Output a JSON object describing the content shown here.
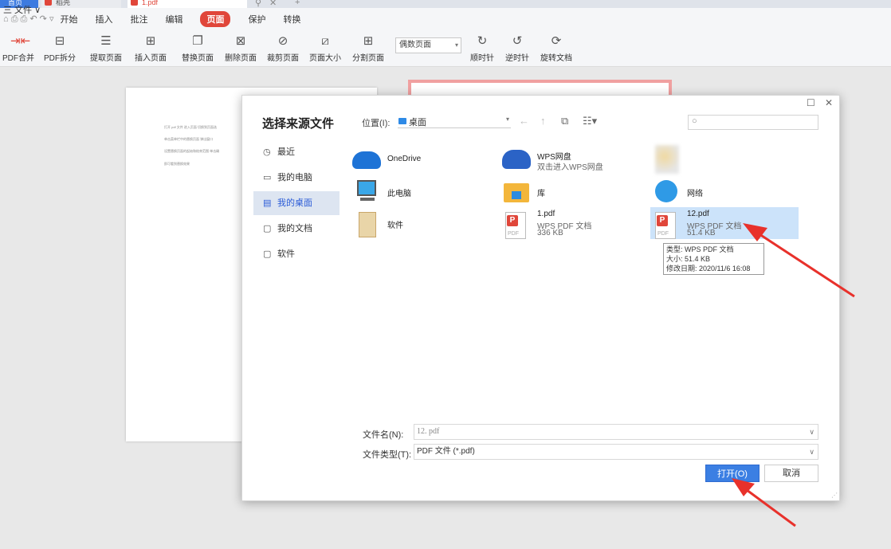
{
  "tabs": {
    "home": "首页",
    "doc1": "稻壳",
    "doc2": "1.pdf"
  },
  "menu": {
    "file": "三 文件 ∨",
    "quick_access": "⌂ ⎙ ⎙ ↶ ↷ ▿",
    "items": [
      "开始",
      "插入",
      "批注",
      "编辑",
      "页面",
      "保护",
      "转换"
    ],
    "active": "页面"
  },
  "toolbar": {
    "buttons": [
      "PDF合并",
      "PDF拆分",
      "提取页面",
      "插入页面",
      "替换页面",
      "删除页面",
      "裁剪页面",
      "页面大小",
      "分割页面",
      "顺时针",
      "逆时针",
      "旋转文档"
    ],
    "page_select": "偶数页面"
  },
  "document": {
    "lines": [
      "打开 pdf 文件   进入页面   切换到页面选",
      "单击菜单栏中的替换页面   弹出窗口",
      "设置替换页面的起始和结束范围   单击确",
      "即可看到替换效果"
    ]
  },
  "dialog": {
    "title": "选择来源文件",
    "location_label": "位置(I):",
    "location_value": "桌面",
    "sidebar": [
      "最近",
      "我的电脑",
      "我的桌面",
      "我的文档",
      "软件"
    ],
    "sidebar_icons": [
      "clock-icon",
      "monitor-icon",
      "desktop-icon",
      "folder-icon",
      "folder-icon"
    ],
    "selected_sidebar": "我的桌面",
    "files": {
      "onedrive": {
        "name": "OneDrive"
      },
      "wps": {
        "name": "WPS网盘",
        "sub": "双击进入WPS网盘"
      },
      "pc": {
        "name": "此电脑"
      },
      "lib": {
        "name": "库"
      },
      "net": {
        "name": "网络"
      },
      "soft": {
        "name": "软件"
      },
      "pdf1": {
        "name": "1.pdf",
        "type": "WPS PDF 文档",
        "size": "336 KB"
      },
      "pdf12": {
        "name": "12.pdf",
        "type": "WPS PDF 文档",
        "size": "51.4 KB"
      }
    },
    "tooltip": {
      "type": "类型: WPS PDF 文档",
      "size": "大小: 51.4 KB",
      "date": "修改日期: 2020/11/6 16:08"
    },
    "filename_label": "文件名(N):",
    "filename_value": "12. pdf",
    "filetype_label": "文件类型(T):",
    "filetype_value": "PDF 文件 (*.pdf)",
    "open_button": "打开(O)",
    "cancel_button": "取消"
  },
  "colors": {
    "accent": "#3b7fe3",
    "active_menu": "#e0463a",
    "selection": "#cce3fa",
    "annotation_arrow": "#e8312b"
  }
}
